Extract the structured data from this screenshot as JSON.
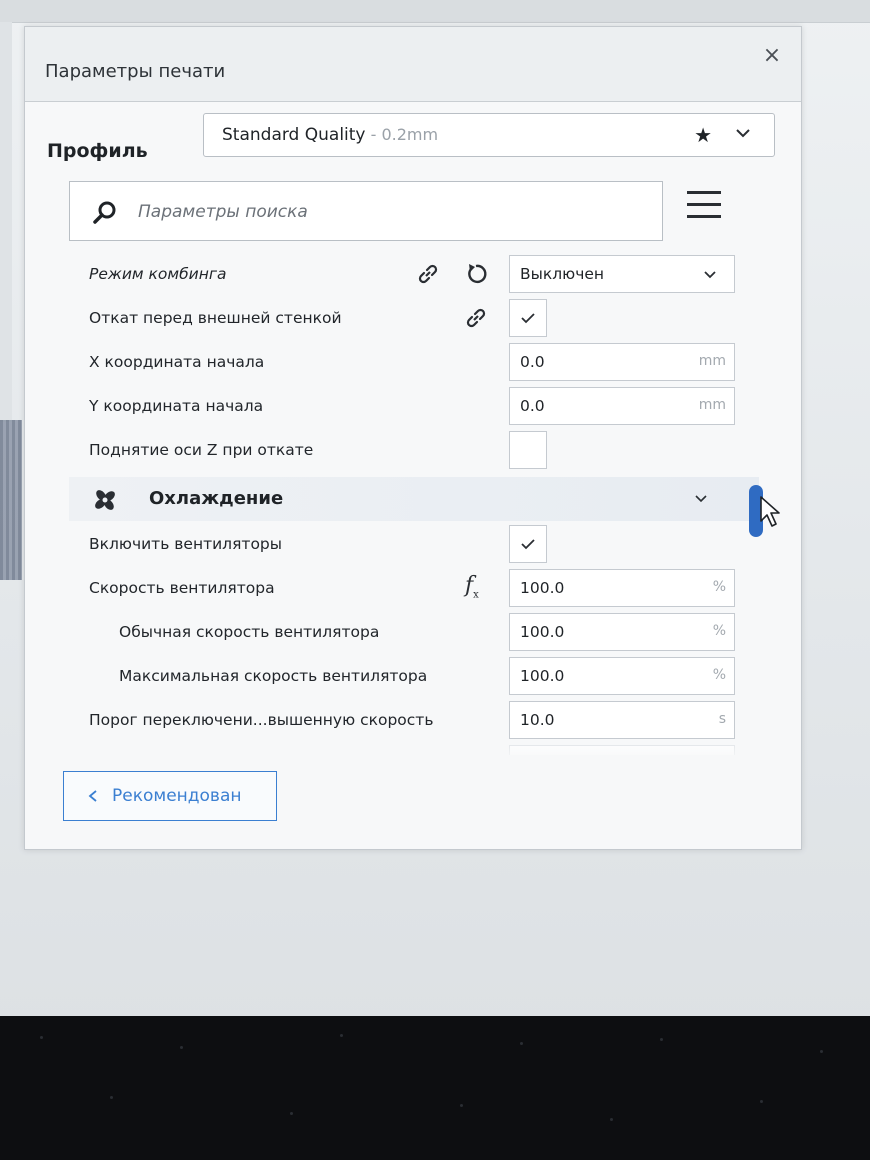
{
  "panel": {
    "title": "Параметры печати",
    "close_glyph": "×"
  },
  "profile": {
    "label": "Профиль",
    "name": "Standard Quality",
    "sub": " - 0.2mm",
    "star_glyph": "★"
  },
  "search": {
    "placeholder": "Параметры поиска"
  },
  "settings": [
    {
      "label": "Режим комбинга",
      "value": "Выключен",
      "type": "dropdown"
    },
    {
      "label": "Откат перед внешней стенкой",
      "type": "checkbox",
      "checked": true
    },
    {
      "label": "X координата начала",
      "value": "0.0",
      "unit": "mm",
      "type": "number"
    },
    {
      "label": "Y координата начала",
      "value": "0.0",
      "unit": "mm",
      "type": "number"
    },
    {
      "label": "Поднятие оси Z при откате",
      "type": "checkbox",
      "checked": false
    }
  ],
  "category": {
    "label": "Охлаждение"
  },
  "cooling_settings": [
    {
      "label": "Включить вентиляторы",
      "type": "checkbox",
      "checked": true
    },
    {
      "label": "Скорость вентилятора",
      "value": "100.0",
      "unit": "%",
      "type": "number"
    },
    {
      "label": "Обычная скорость вентилятора",
      "value": "100.0",
      "unit": "%",
      "type": "number"
    },
    {
      "label": "Максимальная скорость вентилятора",
      "value": "100.0",
      "unit": "%",
      "type": "number"
    },
    {
      "label": "Порог переключени...вышенную скорость",
      "value": "10.0",
      "unit": "s",
      "type": "number"
    }
  ],
  "footer": {
    "recommended_label": "Рекомендован"
  },
  "colors": {
    "accent": "#3b7fd1",
    "scrollbar": "#2f6bc2"
  }
}
